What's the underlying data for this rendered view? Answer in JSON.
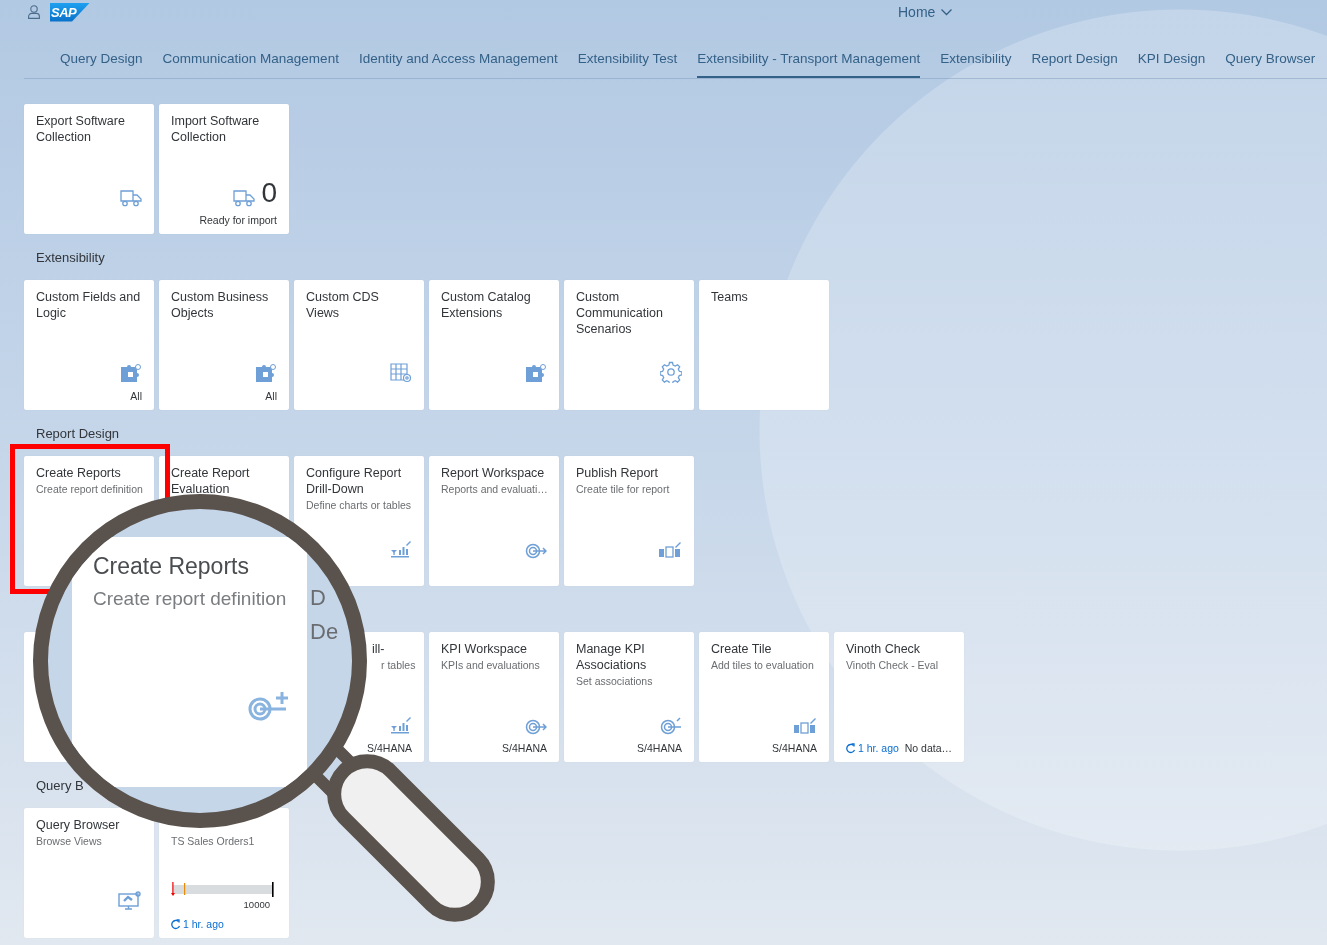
{
  "header": {
    "logo": "SAP",
    "home": "Home"
  },
  "tabs": [
    {
      "label": "Query Design",
      "selected": false
    },
    {
      "label": "Communication Management",
      "selected": false
    },
    {
      "label": "Identity and Access Management",
      "selected": false
    },
    {
      "label": "Extensibility Test",
      "selected": false
    },
    {
      "label": "Extensibility - Transport Management",
      "selected": true
    },
    {
      "label": "Extensibility",
      "selected": false
    },
    {
      "label": "Report Design",
      "selected": false
    },
    {
      "label": "KPI Design",
      "selected": false
    },
    {
      "label": "Query Browser",
      "selected": false
    }
  ],
  "groups": [
    {
      "tiles": [
        {
          "kind": "normal",
          "title": "Export Software Collection"
        },
        {
          "kind": "normal",
          "title": "Import Software Collection",
          "number": "0",
          "footer": "Ready for import"
        }
      ]
    },
    {
      "title": "Extensibility",
      "tiles": [
        {
          "kind": "normal",
          "title": "Custom Fields and Logic",
          "footer": "All"
        },
        {
          "kind": "normal",
          "title": "Custom Business Objects",
          "footer": "All"
        },
        {
          "kind": "normal",
          "title": "Custom CDS Views"
        },
        {
          "kind": "normal",
          "title": "Custom Catalog Extensions"
        },
        {
          "kind": "normal",
          "title": "Custom Communication Scenarios"
        },
        {
          "kind": "normal",
          "title": "Teams"
        }
      ]
    },
    {
      "title": "Report Design",
      "tiles": [
        {
          "kind": "normal",
          "title": "Create Reports",
          "subtitle": "Create report definition"
        },
        {
          "kind": "normal",
          "title": "Create Report Evaluation"
        },
        {
          "kind": "normal",
          "title": "Configure Report Drill-Down",
          "subtitle": "Define charts or tables"
        },
        {
          "kind": "normal",
          "title": "Report Workspace",
          "subtitle": "Reports and evaluati…"
        },
        {
          "kind": "normal",
          "title": "Publish Report",
          "subtitle": "Create tile for report"
        }
      ]
    },
    {
      "tiles": [
        {
          "kind": "covered"
        },
        {
          "kind": "covered"
        },
        {
          "kind": "partial",
          "title": "ill-",
          "subtitle": "r tables",
          "footer": "S/4HANA"
        },
        {
          "kind": "normal",
          "title": "KPI Workspace",
          "subtitle": "KPIs and evaluations",
          "footer": "S/4HANA"
        },
        {
          "kind": "normal",
          "title": "Manage KPI Associations",
          "subtitle": "Set associations",
          "footer": "S/4HANA"
        },
        {
          "kind": "normal",
          "title": "Create Tile",
          "subtitle": "Add tiles to evaluation",
          "footer": "S/4HANA"
        },
        {
          "kind": "normal",
          "title": "Vinoth Check",
          "subtitle": "Vinoth Check - Eval",
          "refresh": "1 hr. ago",
          "footer": "No data…"
        }
      ]
    },
    {
      "title": "Query B",
      "tiles": [
        {
          "kind": "normal",
          "title": "Query Browser",
          "subtitle": "Browse Views"
        },
        {
          "kind": "bullet",
          "subtitle": "TS Sales Orders1",
          "scale": "10000",
          "refresh": "1 hr. ago"
        }
      ]
    }
  ],
  "magnifier": {
    "title": "Create Reports",
    "subtitle": "Create report definition",
    "fragments": [
      "D",
      "De"
    ]
  }
}
